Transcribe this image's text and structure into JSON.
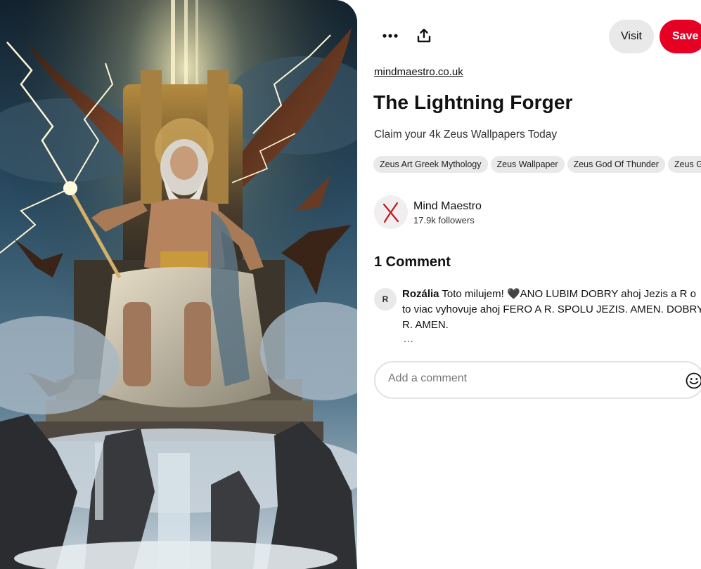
{
  "header": {
    "more_label": "More options",
    "share_label": "Share",
    "visit_label": "Visit",
    "save_label": "Save"
  },
  "pin": {
    "source": "mindmaestro.co.uk",
    "title": "The Lightning Forger",
    "description": "Claim your 4k Zeus Wallpapers Today",
    "tags": [
      "Zeus Art Greek Mythology",
      "Zeus Wallpaper",
      "Zeus God Of Thunder",
      "Zeus Greek"
    ]
  },
  "author": {
    "name": "Mind Maestro",
    "followers": "17.9k followers"
  },
  "comments": {
    "heading": "1 Comment",
    "items": [
      {
        "initial": "R",
        "author": "Rozália",
        "text": " Toto milujem! 🖤ANO LUBIM DOBRY ahoj Jezis a R o to viac vyhovuje ahoj FERO A R. SPOLU JEZIS. AMEN. DOBRY R. AMEN.",
        "more": "..."
      }
    ],
    "input_placeholder": "Add a comment"
  },
  "icons": {
    "more": "ellipsis-icon",
    "share": "share-icon",
    "emoji": "smiley-icon",
    "avatar": "x-logo-icon"
  },
  "colors": {
    "save_button": "#e60023",
    "visit_button": "#e9e9e9",
    "tag_background": "#e9e9e9"
  }
}
